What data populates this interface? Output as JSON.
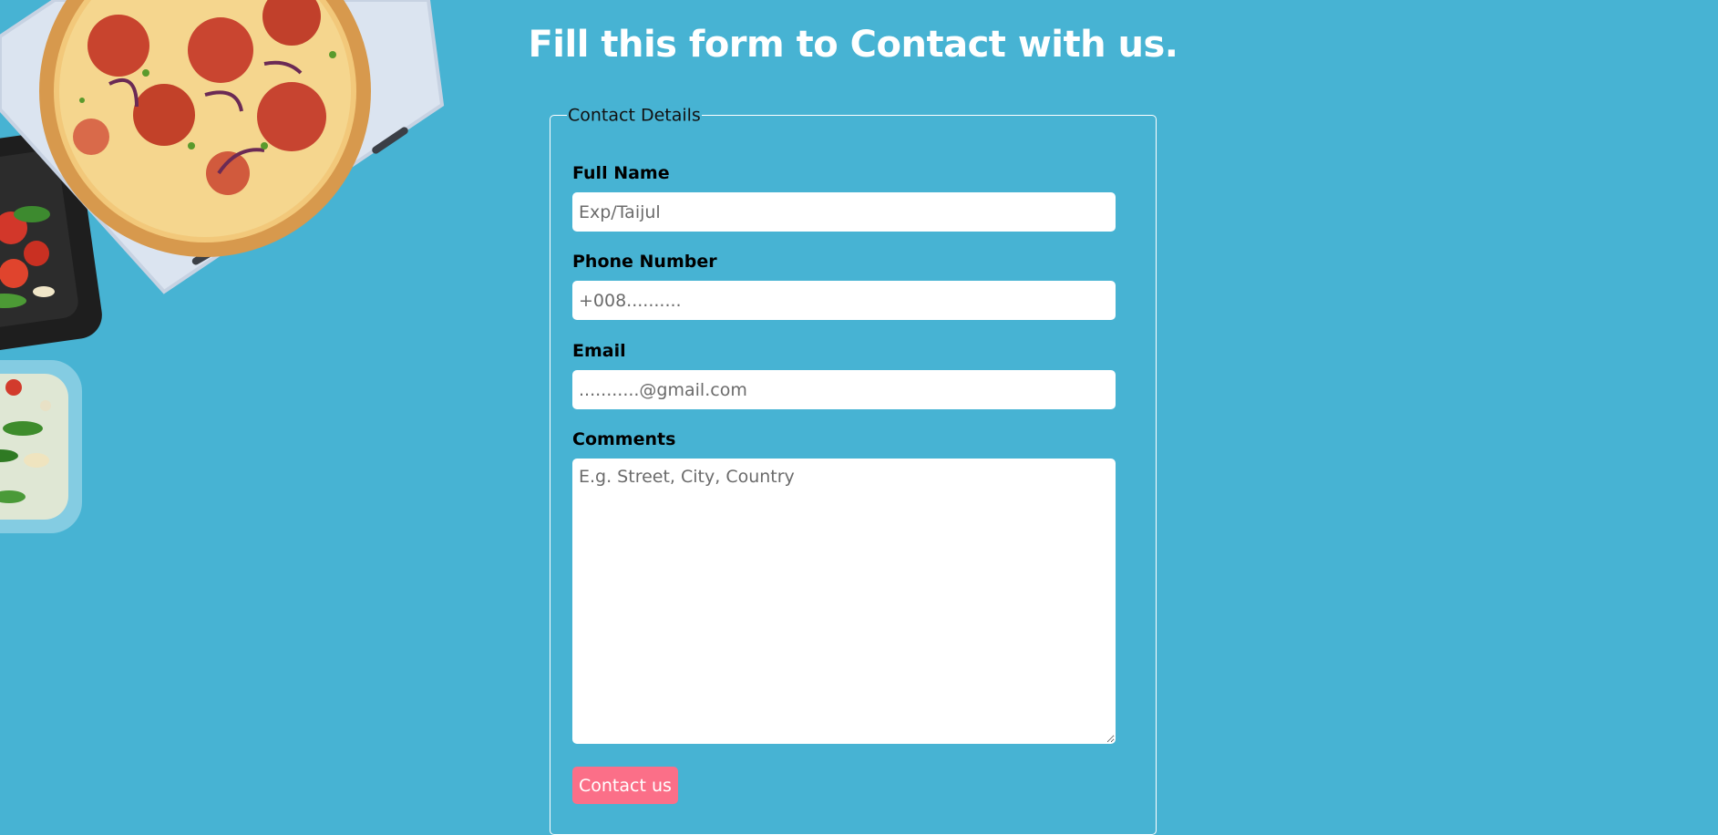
{
  "page": {
    "title": "Fill this form to Contact with us."
  },
  "form": {
    "legend": "Contact Details",
    "full_name": {
      "label": "Full Name",
      "placeholder": "Exp/Taijul",
      "value": ""
    },
    "phone": {
      "label": "Phone Number",
      "placeholder": "+008..........",
      "value": ""
    },
    "email": {
      "label": "Email",
      "placeholder": "...........@gmail.com",
      "value": ""
    },
    "comments": {
      "label": "Comments",
      "placeholder": "E.g. Street, City, Country",
      "value": ""
    },
    "submit_label": "Contact us"
  },
  "colors": {
    "background": "#47b3d3",
    "button": "#fb6f88",
    "title_text": "#ffffff"
  },
  "decoration": {
    "icon": "pizza-and-salad-image"
  }
}
